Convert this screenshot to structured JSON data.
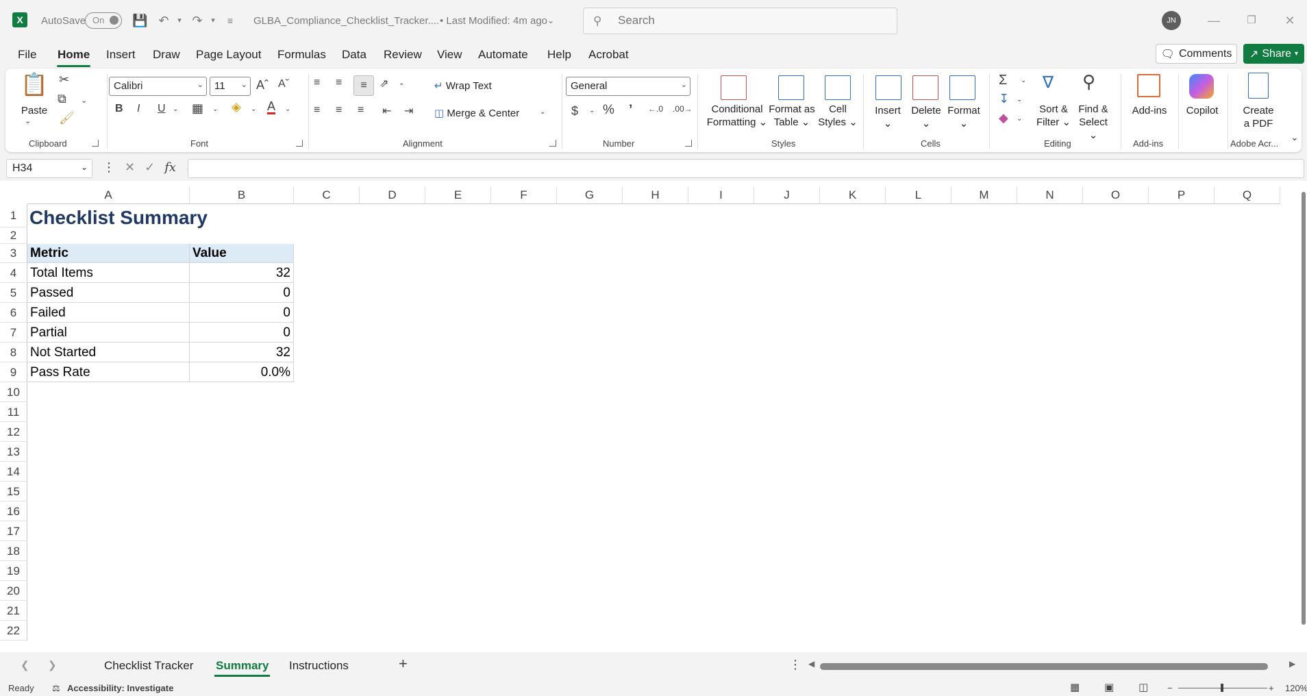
{
  "titlebar": {
    "autosave_label": "AutoSave",
    "autosave_state": "On",
    "doc_title": "GLBA_Compliance_Checklist_Tracker....",
    "doc_modified": "•  Last Modified: 4m ago",
    "search_placeholder": "Search",
    "avatar_initials": "JN"
  },
  "menu": {
    "items": [
      "File",
      "Home",
      "Insert",
      "Draw",
      "Page Layout",
      "Formulas",
      "Data",
      "Review",
      "View",
      "Automate",
      "Help",
      "Acrobat"
    ],
    "active": "Home",
    "comments_label": "Comments",
    "share_label": "Share"
  },
  "ribbon": {
    "clipboard": {
      "paste": "Paste",
      "label": "Clipboard"
    },
    "font": {
      "name": "Calibri",
      "size": "11",
      "label": "Font"
    },
    "alignment": {
      "wrap": "Wrap Text",
      "merge": "Merge & Center",
      "label": "Alignment"
    },
    "number": {
      "format": "General",
      "label": "Number"
    },
    "styles": {
      "conditional_1": "Conditional",
      "conditional_2": "Formatting",
      "format_table_1": "Format as",
      "format_table_2": "Table",
      "cell_styles_1": "Cell",
      "cell_styles_2": "Styles",
      "label": "Styles"
    },
    "cells": {
      "insert": "Insert",
      "delete": "Delete",
      "format": "Format",
      "label": "Cells"
    },
    "editing": {
      "sort_1": "Sort &",
      "sort_2": "Filter",
      "find_1": "Find &",
      "find_2": "Select",
      "label": "Editing"
    },
    "addins": {
      "addins": "Add-ins",
      "label": "Add-ins"
    },
    "copilot": {
      "label": "Copilot"
    },
    "adobe": {
      "create_1": "Create",
      "create_2": "a PDF",
      "label": "Adobe Acr..."
    }
  },
  "formula_bar": {
    "name_box": "H34",
    "formula": ""
  },
  "columns": [
    "A",
    "B",
    "C",
    "D",
    "E",
    "F",
    "G",
    "H",
    "I",
    "J",
    "K",
    "L",
    "M",
    "N",
    "O",
    "P",
    "Q"
  ],
  "rows": [
    "1",
    "2",
    "3",
    "4",
    "5",
    "6",
    "7",
    "8",
    "9",
    "10",
    "11",
    "12",
    "13",
    "14",
    "15",
    "16",
    "17",
    "18",
    "19",
    "20",
    "21",
    "22"
  ],
  "sheet": {
    "title": "Checklist Summary",
    "header": {
      "metric": "Metric",
      "value": "Value"
    },
    "table": [
      {
        "metric": "Total Items",
        "value": "32"
      },
      {
        "metric": "Passed",
        "value": "0"
      },
      {
        "metric": "Failed",
        "value": "0"
      },
      {
        "metric": "Partial",
        "value": "0"
      },
      {
        "metric": "Not Started",
        "value": "32"
      },
      {
        "metric": "Pass Rate",
        "value": "0.0%"
      }
    ]
  },
  "tabs": {
    "items": [
      "Checklist Tracker",
      "Summary",
      "Instructions"
    ],
    "active": "Summary"
  },
  "status": {
    "ready": "Ready",
    "accessibility": "Accessibility: Investigate",
    "zoom": "120%"
  },
  "colors": {
    "accent": "#107c41",
    "title": "#1f3864",
    "header_fill": "#ddebf7"
  }
}
